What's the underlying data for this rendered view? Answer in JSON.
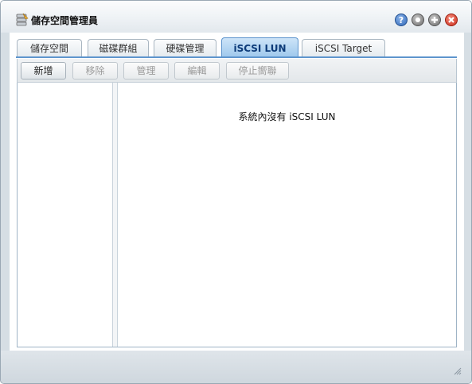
{
  "window": {
    "title": "儲存空間管理員",
    "app_icon": "storage-manager-icon",
    "controls": {
      "help": "?",
      "help_icon": "help-icon",
      "minimize_icon": "minimize-icon",
      "maximize_icon": "maximize-icon",
      "close_icon": "close-icon"
    }
  },
  "tabs": [
    {
      "label": "儲存空間",
      "active": false
    },
    {
      "label": "磁碟群組",
      "active": false
    },
    {
      "label": "硬碟管理",
      "active": false
    },
    {
      "label": "iSCSI LUN",
      "active": true
    },
    {
      "label": "iSCSI Target",
      "active": false
    }
  ],
  "toolbar": {
    "create": "新增",
    "remove": "移除",
    "manage": "管理",
    "edit": "編輯",
    "unmap": "停止嚮聯"
  },
  "main": {
    "empty_message": "系統內沒有 iSCSI LUN"
  },
  "colors": {
    "accent": "#5e95cd",
    "active_tab_text": "#0c3a78",
    "window_frame": "#d6dee4"
  }
}
